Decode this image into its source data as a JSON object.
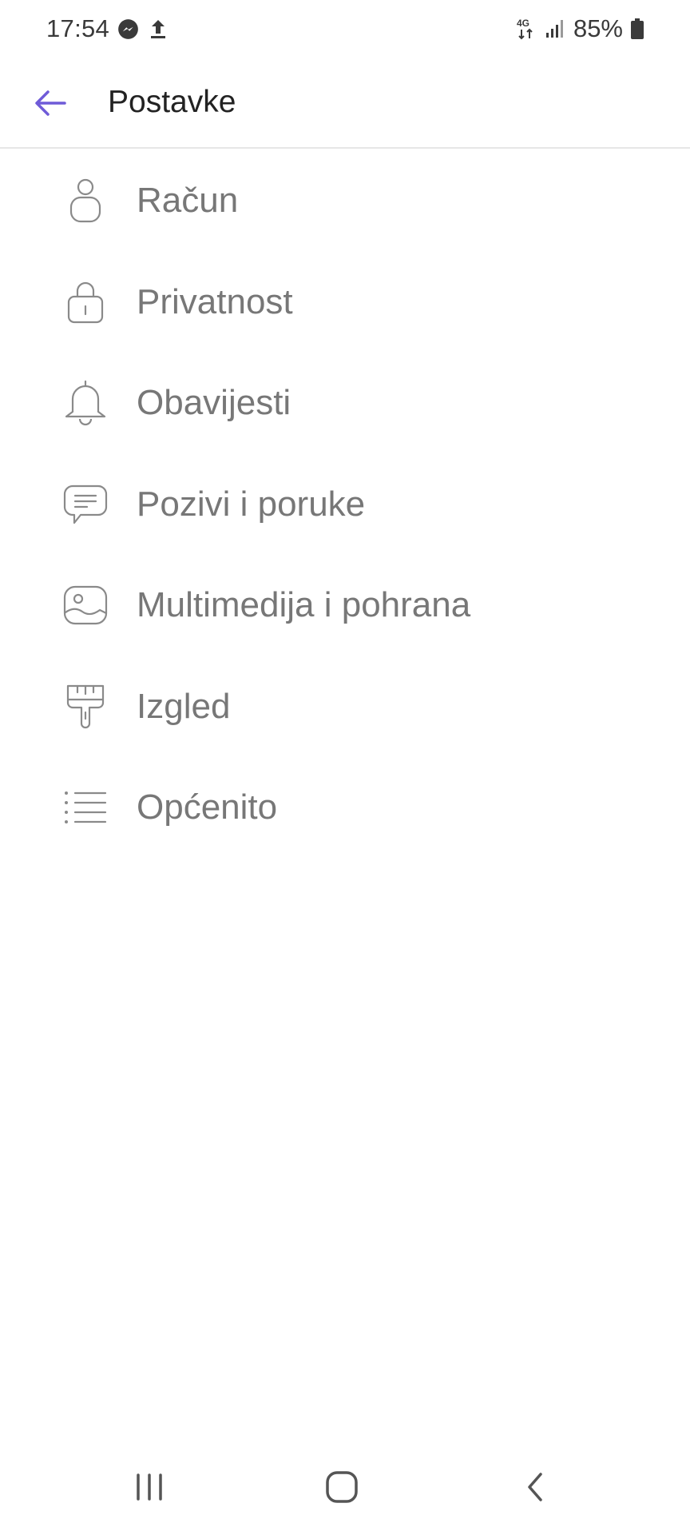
{
  "status_bar": {
    "time": "17:54",
    "network": "4G",
    "battery": "85%"
  },
  "app_bar": {
    "title": "Postavke",
    "accent_color": "#6f5bd8"
  },
  "settings": {
    "items": [
      {
        "label": "Račun",
        "icon": "account-icon"
      },
      {
        "label": "Privatnost",
        "icon": "lock-icon"
      },
      {
        "label": "Obavijesti",
        "icon": "bell-icon"
      },
      {
        "label": "Pozivi i poruke",
        "icon": "chat-bubble-icon"
      },
      {
        "label": "Multimedija i pohrana",
        "icon": "image-icon"
      },
      {
        "label": "Izgled",
        "icon": "paint-brush-icon"
      },
      {
        "label": "Općenito",
        "icon": "list-icon"
      }
    ]
  },
  "nav_bar": {
    "buttons": [
      "recents",
      "home",
      "back"
    ]
  }
}
